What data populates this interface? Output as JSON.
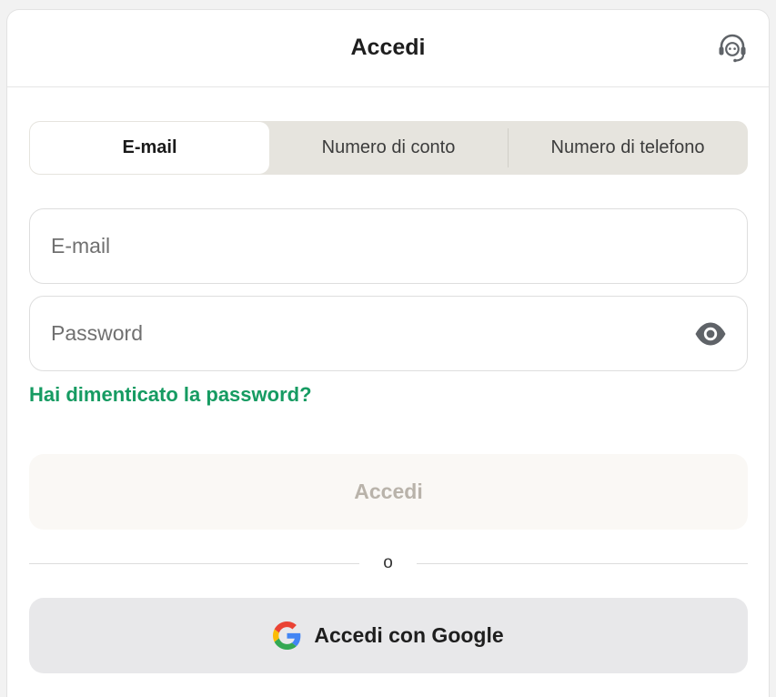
{
  "header": {
    "title": "Accedi",
    "support_icon": "headset-icon"
  },
  "tabs": [
    {
      "label": "E-mail",
      "selected": true
    },
    {
      "label": "Numero di conto",
      "selected": false
    },
    {
      "label": "Numero di telefono",
      "selected": false
    }
  ],
  "form": {
    "email_placeholder": "E-mail",
    "email_value": "",
    "password_placeholder": "Password",
    "password_value": "",
    "password_toggle_icon": "eye-icon",
    "forgot_link": "Hai dimenticato la password?",
    "submit_label": "Accedi",
    "submit_enabled": false
  },
  "divider": {
    "text": "o"
  },
  "google": {
    "label": "Accedi con Google",
    "icon": "google-logo-icon"
  },
  "colors": {
    "link_green": "#169b62",
    "tabs_bg": "#e6e4de",
    "submit_bg_disabled": "#faf8f5",
    "submit_text_disabled": "#b9b3aa",
    "google_btn_bg": "#e8e8ea",
    "icon_gray": "#5f6368"
  }
}
